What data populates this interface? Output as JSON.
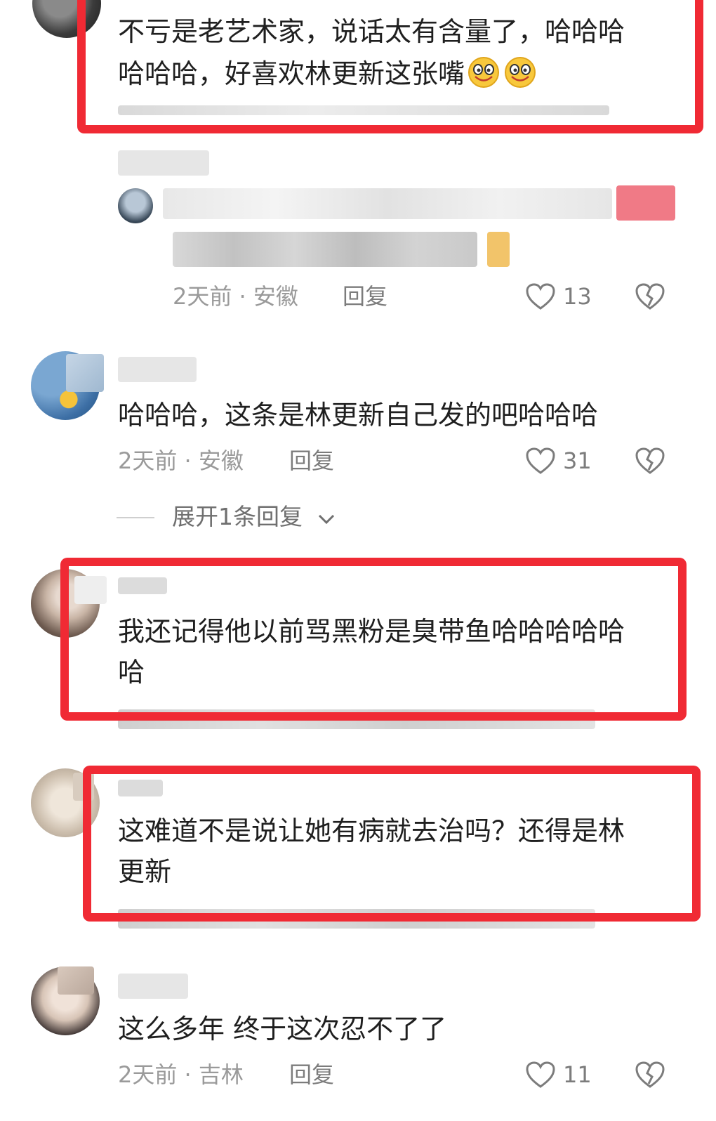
{
  "comments": [
    {
      "text_lines": [
        "不亏是老艺术家，说话太有含量了，哈哈哈",
        "哈哈哈，好喜欢林更新这张嘴"
      ],
      "emoji": [
        "smile-emoji",
        "smile-emoji"
      ]
    },
    {
      "reply_meta": "2天前 · 安徽",
      "reply_label": "回复",
      "likes": "13"
    },
    {
      "text": "哈哈哈，这条是林更新自己发的吧哈哈哈",
      "meta": "2天前 · 安徽",
      "reply_label": "回复",
      "likes": "31",
      "expand_label": "展开1条回复"
    },
    {
      "text_lines": [
        "我还记得他以前骂黑粉是臭带鱼哈哈哈哈哈",
        "哈"
      ]
    },
    {
      "text_lines": [
        "这难道不是说让她有病就去治吗？还得是林",
        "更新"
      ]
    },
    {
      "text": "这么多年 终于这次忍不了了",
      "meta": "2天前 · 吉林",
      "reply_label": "回复",
      "likes": "11"
    }
  ],
  "colors": {
    "highlight": "#f02a34",
    "meta": "#9a9a9a",
    "text": "#1f1f1f"
  }
}
